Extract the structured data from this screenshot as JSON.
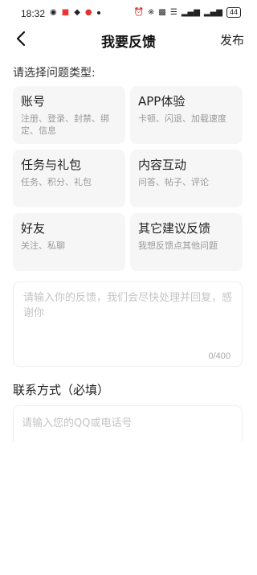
{
  "status_bar": {
    "time": "18:32",
    "battery": "44"
  },
  "header": {
    "title": "我要反馈",
    "publish_label": "发布"
  },
  "issue_section": {
    "label": "请选择问题类型:",
    "categories": [
      {
        "title": "账号",
        "desc": "注册、登录、封禁、绑定、信息"
      },
      {
        "title": "APP体验",
        "desc": "卡顿、闪退、加载速度"
      },
      {
        "title": "任务与礼包",
        "desc": "任务、积分、礼包"
      },
      {
        "title": "内容互动",
        "desc": "问答、帖子、评论"
      },
      {
        "title": "好友",
        "desc": "关注、私聊"
      },
      {
        "title": "其它建议反馈",
        "desc": "我想反馈点其他问题"
      }
    ]
  },
  "feedback": {
    "placeholder": "请输入你的反馈，我们会尽快处理并回复，感谢你",
    "value": "",
    "counter": "0/400"
  },
  "contact": {
    "label": "联系方式（必填）",
    "placeholder": "请输入您的QQ或电话号",
    "value": ""
  }
}
